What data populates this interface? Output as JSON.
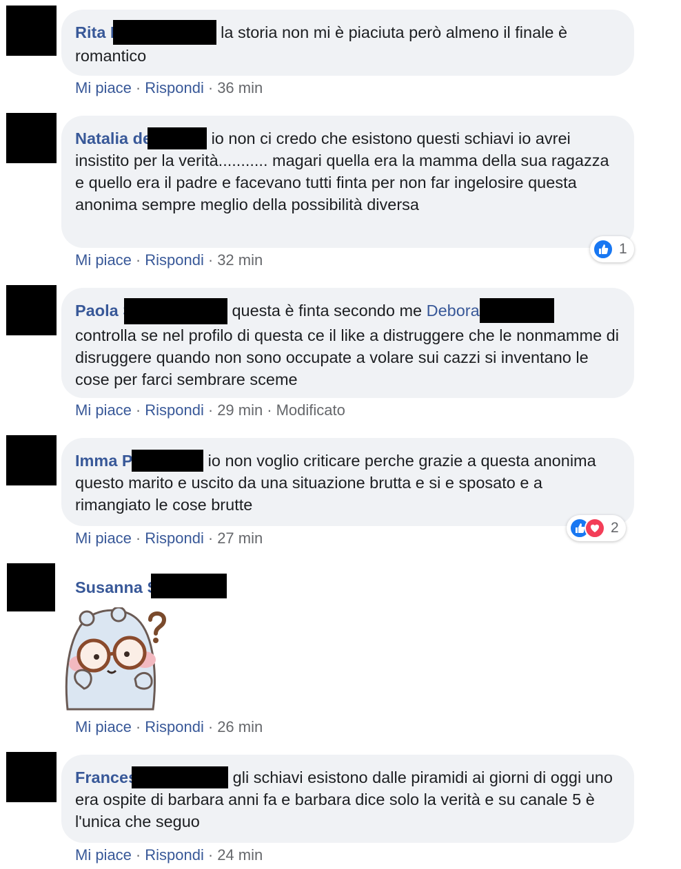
{
  "comments": [
    {
      "author": "Rita P",
      "text": "la storia non mi è piaciuta però almeno il finale è romantico",
      "actions": {
        "like": "Mi piace",
        "reply": "Rispondi",
        "time": "36 min"
      }
    },
    {
      "author": "Natalia de",
      "text": "io non ci credo che esistono questi schiavi io avrei insistito per la verità........... magari quella era la mamma della sua ragazza e quello era il padre e facevano tutti finta per non far ingelosire questa anonima sempre meglio della possibilità diversa",
      "reactions": {
        "count": "1",
        "icons": [
          "like-icon"
        ]
      },
      "actions": {
        "like": "Mi piace",
        "reply": "Rispondi",
        "time": "32 min"
      }
    },
    {
      "author": "Paola S",
      "text_before": "questa è finta secondo me",
      "mention": "Debora",
      "text_after": "controlla se nel profilo di questa ce il like a distruggere che le nonmamme di disruggere quando non sono occupate a volare sui cazzi si inventano le cose per farci sembrare sceme",
      "actions": {
        "like": "Mi piace",
        "reply": "Rispondi",
        "time": "29 min",
        "edited": "Modificato"
      }
    },
    {
      "author": "Imma Pi",
      "text": "io non voglio criticare perche grazie a questa anonima questo marito e uscito da una situazione brutta e si e sposato e a rimangiato le cose brutte",
      "reactions": {
        "count": "2",
        "icons": [
          "like-icon",
          "love-icon"
        ]
      },
      "actions": {
        "like": "Mi piace",
        "reply": "Rispondi",
        "time": "27 min"
      }
    },
    {
      "author": "Susanna S",
      "sticker": "confused-bear-sticker",
      "actions": {
        "like": "Mi piace",
        "reply": "Rispondi",
        "time": "26 min"
      }
    },
    {
      "author": "Frances",
      "text": "gli schiavi esistono dalle piramidi ai giorni di oggi uno era ospite di barbara anni fa e barbara dice solo la verità e su canale 5 è l'unica che seguo",
      "actions": {
        "like": "Mi piace",
        "reply": "Rispondi",
        "time": "24 min"
      }
    }
  ],
  "colors": {
    "bubble": "#f0f2f5",
    "link": "#385898",
    "meta": "#65676b",
    "like": "#1877f2",
    "love": "#f33e58"
  }
}
